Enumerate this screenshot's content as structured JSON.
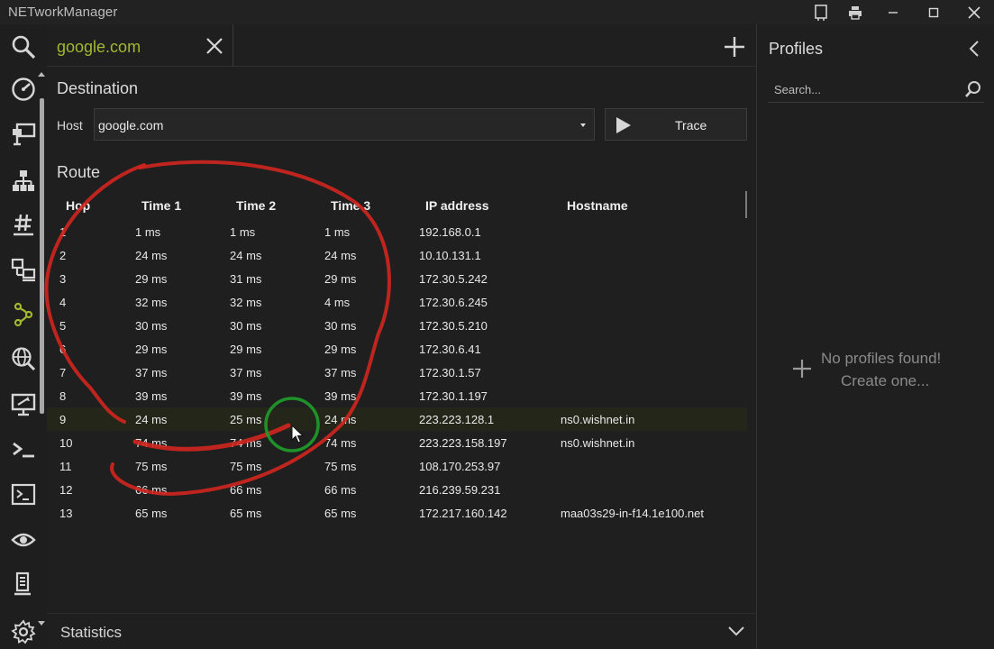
{
  "window": {
    "title": "NETworkManager"
  },
  "tab": {
    "label": "google.com"
  },
  "destination": {
    "title": "Destination",
    "host_label": "Host",
    "host_value": "google.com",
    "trace_label": "Trace"
  },
  "route": {
    "title": "Route",
    "columns": [
      "Hop",
      "Time 1",
      "Time 2",
      "Time 3",
      "IP address",
      "Hostname"
    ],
    "rows": [
      {
        "hop": "1",
        "t1": "1 ms",
        "t2": "1 ms",
        "t3": "1 ms",
        "ip": "192.168.0.1",
        "host": ""
      },
      {
        "hop": "2",
        "t1": "24 ms",
        "t2": "24 ms",
        "t3": "24 ms",
        "ip": "10.10.131.1",
        "host": ""
      },
      {
        "hop": "3",
        "t1": "29 ms",
        "t2": "31 ms",
        "t3": "29 ms",
        "ip": "172.30.5.242",
        "host": ""
      },
      {
        "hop": "4",
        "t1": "32 ms",
        "t2": "32 ms",
        "t3": "4 ms",
        "ip": "172.30.6.245",
        "host": ""
      },
      {
        "hop": "5",
        "t1": "30 ms",
        "t2": "30 ms",
        "t3": "30 ms",
        "ip": "172.30.5.210",
        "host": ""
      },
      {
        "hop": "6",
        "t1": "29 ms",
        "t2": "29 ms",
        "t3": "29 ms",
        "ip": "172.30.6.41",
        "host": ""
      },
      {
        "hop": "7",
        "t1": "37 ms",
        "t2": "37 ms",
        "t3": "37 ms",
        "ip": "172.30.1.57",
        "host": ""
      },
      {
        "hop": "8",
        "t1": "39 ms",
        "t2": "39 ms",
        "t3": "39 ms",
        "ip": "172.30.1.197",
        "host": ""
      },
      {
        "hop": "9",
        "t1": "24 ms",
        "t2": "25 ms",
        "t3": "24 ms",
        "ip": "223.223.128.1",
        "host": "ns0.wishnet.in"
      },
      {
        "hop": "10",
        "t1": "74 ms",
        "t2": "74 ms",
        "t3": "74 ms",
        "ip": "223.223.158.197",
        "host": "ns0.wishnet.in"
      },
      {
        "hop": "11",
        "t1": "75 ms",
        "t2": "75 ms",
        "t3": "75 ms",
        "ip": "108.170.253.97",
        "host": ""
      },
      {
        "hop": "12",
        "t1": "66 ms",
        "t2": "66 ms",
        "t3": "66 ms",
        "ip": "216.239.59.231",
        "host": ""
      },
      {
        "hop": "13",
        "t1": "65 ms",
        "t2": "65 ms",
        "t3": "65 ms",
        "ip": "172.217.160.142",
        "host": "maa03s29-in-f14.1e100.net"
      }
    ]
  },
  "statistics": {
    "label": "Statistics"
  },
  "profiles": {
    "title": "Profiles",
    "search_placeholder": "Search...",
    "empty_line1": "No profiles found!",
    "empty_line2": "Create one..."
  },
  "nav_icons": [
    "search-icon",
    "dashboard-icon",
    "network-interface-icon",
    "ip-scanner-icon",
    "port-scanner-icon",
    "remote-desktop-icon",
    "traceroute-icon",
    "dns-lookup-icon",
    "wake-on-lan-icon",
    "powershell-icon",
    "terminal-icon",
    "watch-icon",
    "server-icon",
    "settings-icon"
  ],
  "colors": {
    "accent": "#a3b830",
    "background": "#1e1e1e",
    "selected_row": "#232619",
    "annotation_red": "#d0261e",
    "annotation_green": "#1f9d2a"
  }
}
